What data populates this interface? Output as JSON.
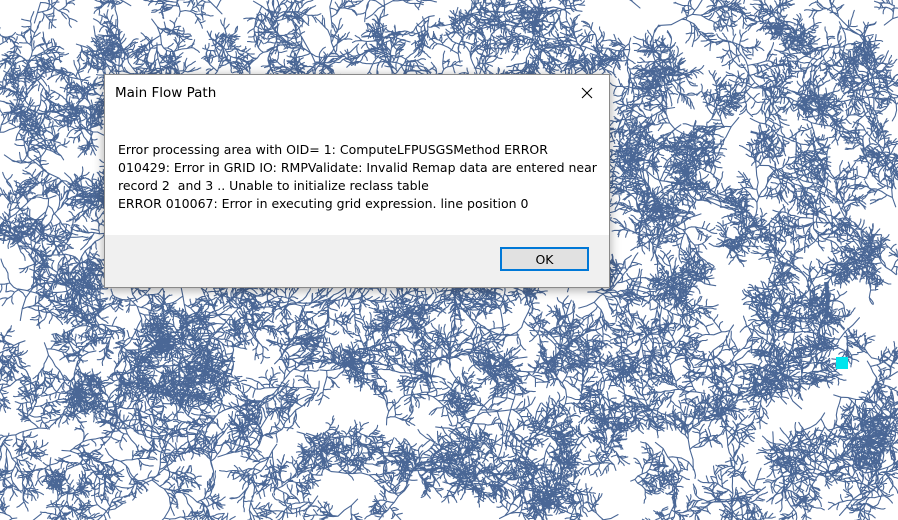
{
  "map": {
    "stream_color": "#4a6796",
    "outlet_color": "#00e5ee"
  },
  "dialog": {
    "title": "Main Flow Path",
    "close_icon": "close-icon",
    "message": "Error processing area with OID= 1: ComputeLFPUSGSMethod ERROR 010429: Error in GRID IO: RMPValidate: Invalid Remap data are entered near record 2  and 3 .. Unable to initialize reclass table\nERROR 010067: Error in executing grid expression. line position 0",
    "ok_label": "OK"
  }
}
